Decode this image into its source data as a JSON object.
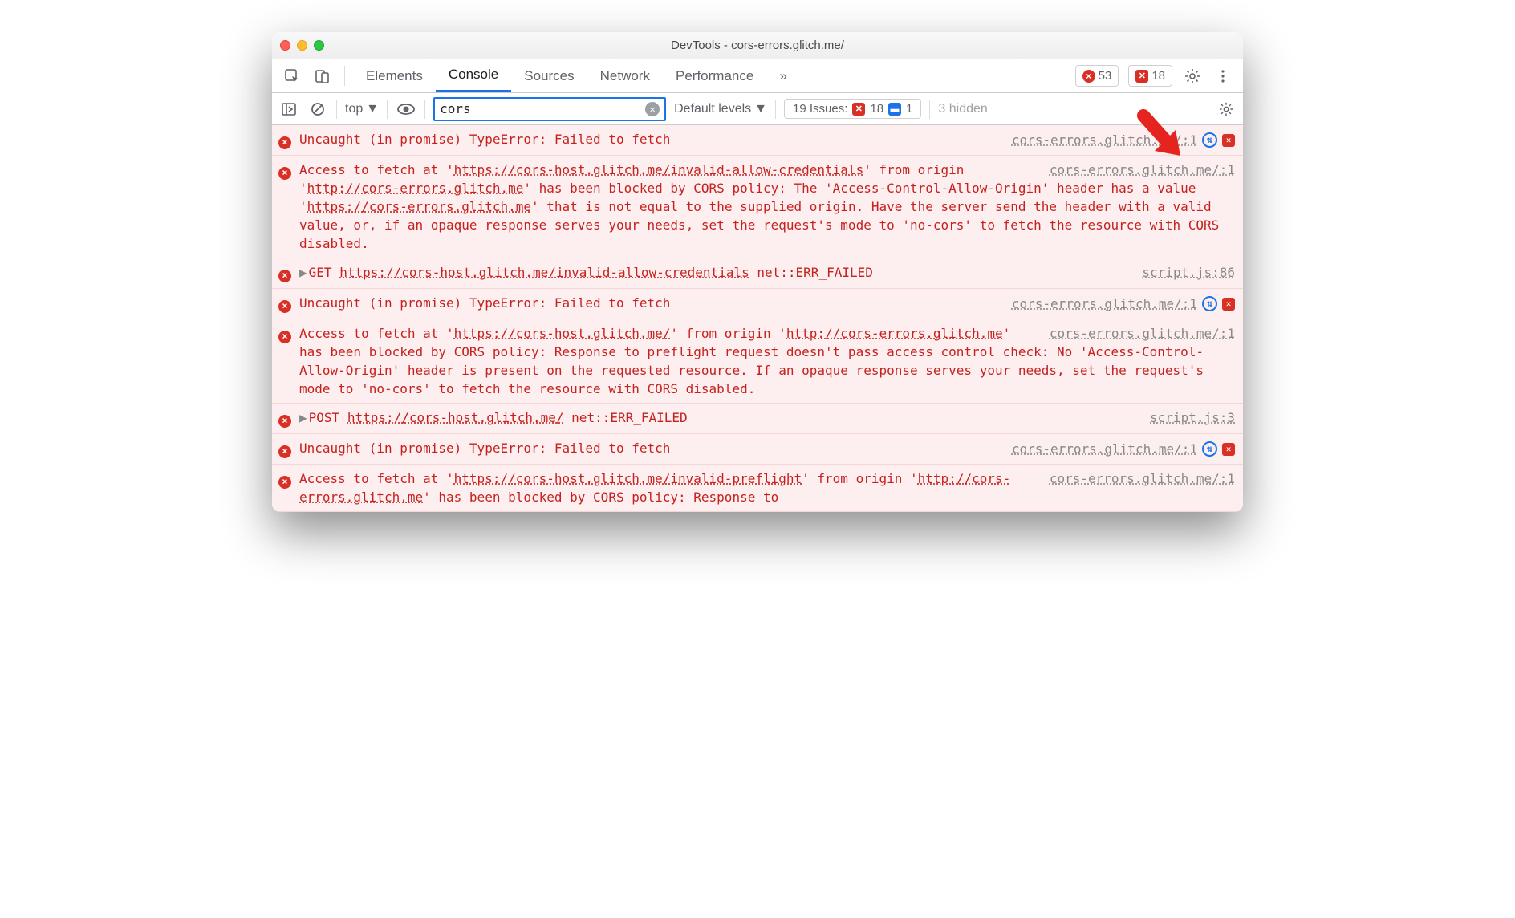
{
  "window": {
    "title": "DevTools - cors-errors.glitch.me/"
  },
  "tabs": {
    "items": [
      "Elements",
      "Console",
      "Sources",
      "Network",
      "Performance"
    ],
    "active": "Console",
    "more": "»"
  },
  "counters": {
    "errors": "53",
    "issues_badge": "18"
  },
  "toolbar": {
    "context": "top",
    "filter_value": "cors",
    "levels": "Default levels",
    "issues_label": "19 Issues:",
    "issues_err": "18",
    "issues_info": "1",
    "hidden_text": "3 hidden"
  },
  "entries": [
    {
      "type": "simple",
      "text": "Uncaught (in promise) TypeError: Failed to fetch",
      "src": "cors-errors.glitch.me/:1",
      "has_net": true,
      "has_issue": true
    },
    {
      "type": "cors",
      "src": "cors-errors.glitch.me/:1",
      "pre": "Access to fetch at '",
      "url1": "https://cors-host.glitch.me/invalid-allow-credentials",
      "mid1": "' from origin '",
      "url2": "http://cors-errors.glitch.me",
      "mid2": "' has been blocked by CORS policy: The 'Access-Control-Allow-Origin' header has a value '",
      "url3": "https://cors-errors.glitch.me",
      "tail": "' that is not equal to the supplied origin. Have the server send the header with a valid value, or, if an opaque response serves your needs, set the request's mode to 'no-cors' to fetch the resource with CORS disabled."
    },
    {
      "type": "net",
      "method": "GET",
      "url": "https://cors-host.glitch.me/invalid-allow-credentials",
      "status": "net::ERR_FAILED",
      "src": "script.js:86"
    },
    {
      "type": "simple",
      "text": "Uncaught (in promise) TypeError: Failed to fetch",
      "src": "cors-errors.glitch.me/:1",
      "has_net": true,
      "has_issue": true
    },
    {
      "type": "cors",
      "src": "cors-errors.glitch.me/:1",
      "pre": "Access to fetch at '",
      "url1": "https://cors-host.glitch.me/",
      "mid1": "' from origin '",
      "url2": "http://cors-errors.glitch.me",
      "tail": "' has been blocked by CORS policy: Response to preflight request doesn't pass access control check: No 'Access-Control-Allow-Origin' header is present on the requested resource. If an opaque response serves your needs, set the request's mode to 'no-cors' to fetch the resource with CORS disabled."
    },
    {
      "type": "net",
      "method": "POST",
      "url": "https://cors-host.glitch.me/",
      "status": "net::ERR_FAILED",
      "src": "script.js:3"
    },
    {
      "type": "simple",
      "text": "Uncaught (in promise) TypeError: Failed to fetch",
      "src": "cors-errors.glitch.me/:1",
      "has_net": true,
      "has_issue": true
    },
    {
      "type": "cors",
      "src": "cors-errors.glitch.me/:1",
      "pre": "Access to fetch at '",
      "url1": "https://cors-host.glitch.me/invalid-preflight",
      "mid1": "' from origin '",
      "url2": "http://cors-errors.glitch.me",
      "tail": "' has been blocked by CORS policy: Response to"
    }
  ]
}
